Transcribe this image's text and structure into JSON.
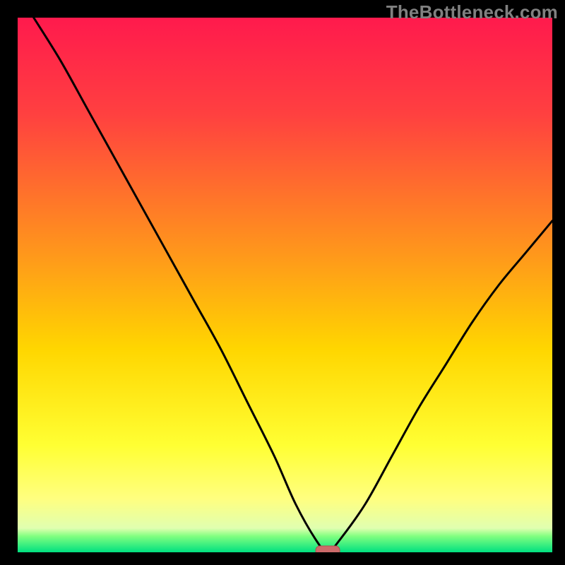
{
  "watermark": "TheBottleneck.com",
  "colors": {
    "frame": "#000000",
    "gradient_top": "#ff1a4d",
    "gradient_mid": "#ffd600",
    "gradient_bottom_yellow": "#ffff80",
    "gradient_green1": "#80ff80",
    "gradient_green2": "#00e080",
    "curve": "#000000",
    "marker_fill": "#cc6a6a",
    "marker_stroke": "#b05050"
  },
  "chart_data": {
    "type": "line",
    "title": "",
    "xlabel": "",
    "ylabel": "",
    "xlim": [
      0,
      100
    ],
    "ylim": [
      0,
      100
    ],
    "x": [
      3,
      8,
      13,
      18,
      23,
      28,
      33,
      38,
      43,
      48,
      52,
      56,
      58,
      60,
      65,
      70,
      75,
      80,
      85,
      90,
      95,
      100
    ],
    "values": [
      100,
      92,
      83,
      74,
      65,
      56,
      47,
      38,
      28,
      18,
      9,
      2,
      0,
      2,
      9,
      18,
      27,
      35,
      43,
      50,
      56,
      62
    ],
    "minimum": {
      "x": 58,
      "y": 0
    },
    "annotations": [
      {
        "type": "marker",
        "shape": "rounded-rect",
        "x": 58,
        "y": 0,
        "label": ""
      }
    ]
  },
  "plot_geometry": {
    "inner_left": 25,
    "inner_top": 25,
    "inner_width": 757,
    "inner_height": 757
  }
}
